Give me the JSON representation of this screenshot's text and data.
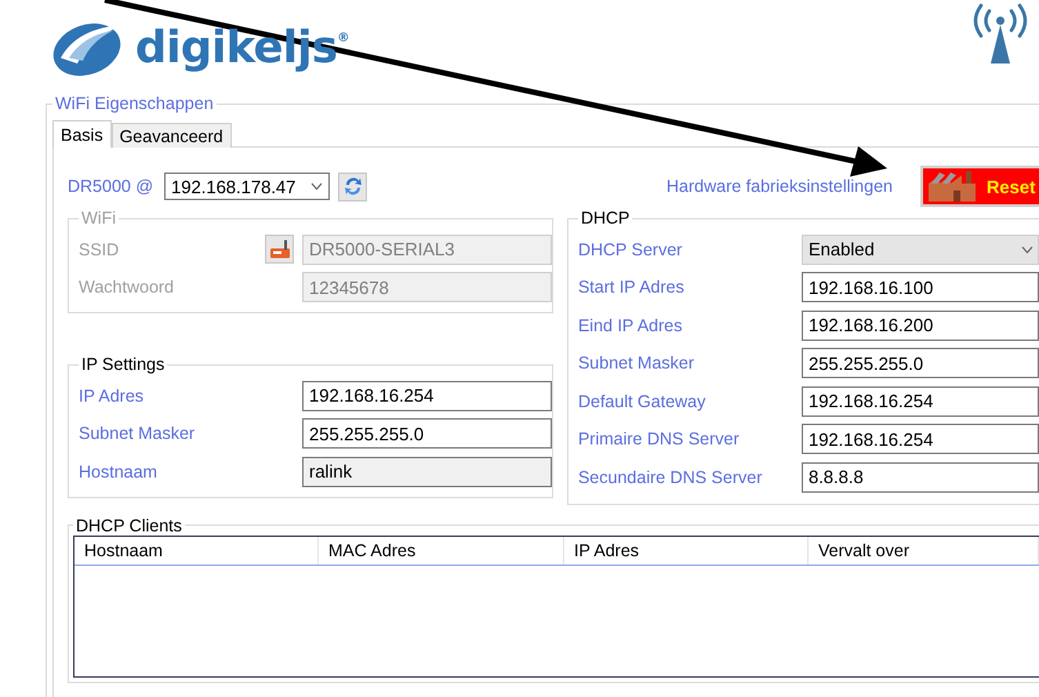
{
  "logo": {
    "text": "digikeljs$^{®}$"
  },
  "panel": {
    "title": "WiFi Eigenschappen"
  },
  "tabs": [
    {
      "label": "Basis",
      "selected": true
    },
    {
      "label": "Geavanceerd",
      "selected": false
    }
  ],
  "device": {
    "label": "DR5000 @",
    "value": "192.168.178.47"
  },
  "factory": {
    "label": "Hardware fabrieksinstellingen",
    "button": "Reset"
  },
  "wifi": {
    "title": "WiFi",
    "disabled": true,
    "fields": [
      {
        "label": "SSID",
        "value": "DR5000-SERIAL3",
        "editable": false,
        "has_icon": true
      },
      {
        "label": "Wachtwoord",
        "value": "12345678",
        "editable": false,
        "has_icon": false
      }
    ]
  },
  "ip_settings": {
    "title": "IP Settings",
    "fields": [
      {
        "label": "IP Adres",
        "value": "192.168.16.254",
        "editable": true
      },
      {
        "label": "Subnet Masker",
        "value": "255.255.255.0",
        "editable": true
      },
      {
        "label": "Hostnaam",
        "value": "ralink",
        "editable": false
      }
    ]
  },
  "dhcp": {
    "title": "DHCP",
    "fields": [
      {
        "label": "DHCP Server",
        "value": "Enabled",
        "kind": "select"
      },
      {
        "label": "Start IP Adres",
        "value": "192.168.16.100",
        "kind": "text"
      },
      {
        "label": "Eind IP Adres",
        "value": "192.168.16.200",
        "kind": "text"
      },
      {
        "label": "Subnet Masker",
        "value": "255.255.255.0",
        "kind": "text"
      },
      {
        "label": "Default Gateway",
        "value": "192.168.16.254",
        "kind": "text"
      },
      {
        "label": "Primaire DNS Server",
        "value": "192.168.16.254",
        "kind": "text"
      },
      {
        "label": "Secundaire DNS Server",
        "value": "8.8.8.8",
        "kind": "text"
      }
    ]
  },
  "clients": {
    "title": "DHCP Clients",
    "columns": [
      "Hostnaam",
      "MAC Adres",
      "IP Adres",
      "Vervalt over"
    ]
  }
}
